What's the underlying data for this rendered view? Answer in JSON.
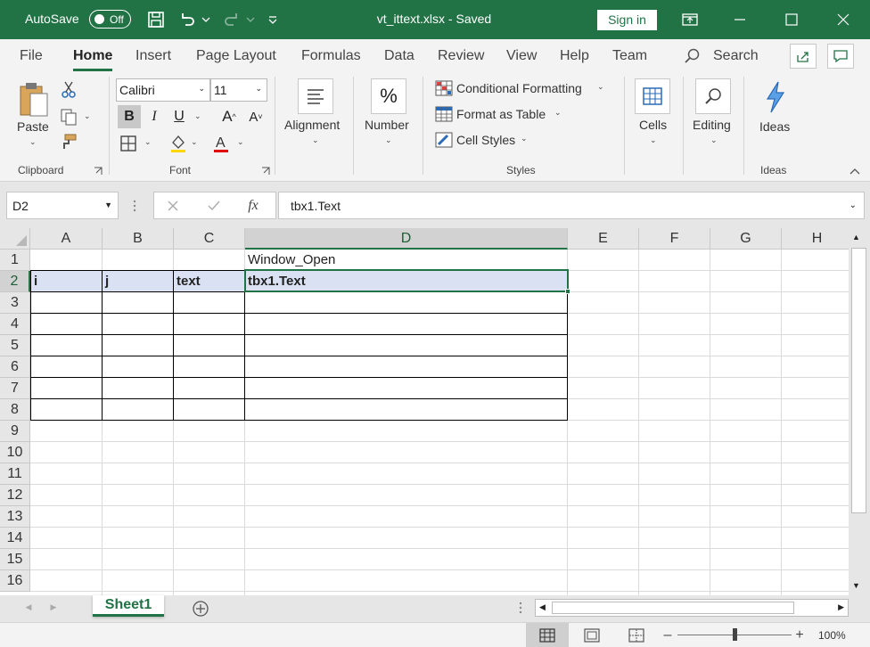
{
  "titlebar": {
    "autosave_label": "AutoSave",
    "autosave_state": "Off",
    "document_title": "vt_ittext.xlsx  -  Saved",
    "signin_label": "Sign in"
  },
  "tabs": [
    "File",
    "Home",
    "Insert",
    "Page Layout",
    "Formulas",
    "Data",
    "Review",
    "View",
    "Help",
    "Team"
  ],
  "search_label": "Search",
  "ribbon": {
    "clipboard": {
      "paste_label": "Paste",
      "group_label": "Clipboard"
    },
    "font": {
      "font_name": "Calibri",
      "font_size": "11",
      "group_label": "Font"
    },
    "alignment_label": "Alignment",
    "number_label": "Number",
    "styles": {
      "conditional_formatting": "Conditional Formatting",
      "format_as_table": "Format as Table",
      "cell_styles": "Cell Styles",
      "group_label": "Styles"
    },
    "cells_label": "Cells",
    "editing_label": "Editing",
    "ideas": {
      "button_label": "Ideas",
      "group_label": "Ideas"
    }
  },
  "formula_bar": {
    "name_box": "D2",
    "formula": "tbx1.Text"
  },
  "columns": [
    "A",
    "B",
    "C",
    "D",
    "E",
    "F",
    "G",
    "H"
  ],
  "rows": [
    "1",
    "2",
    "3",
    "4",
    "5",
    "6",
    "7",
    "8",
    "9",
    "10",
    "11",
    "12",
    "13",
    "14",
    "15",
    "16"
  ],
  "cells": {
    "D1": "Window_Open",
    "A2": "i",
    "B2": "j",
    "C2": "text",
    "D2": "tbx1.Text"
  },
  "sheet_tab": "Sheet1",
  "status": {
    "zoom": "100%"
  },
  "colors": {
    "accent": "#217346",
    "header_fill": "#d9e1f2"
  }
}
